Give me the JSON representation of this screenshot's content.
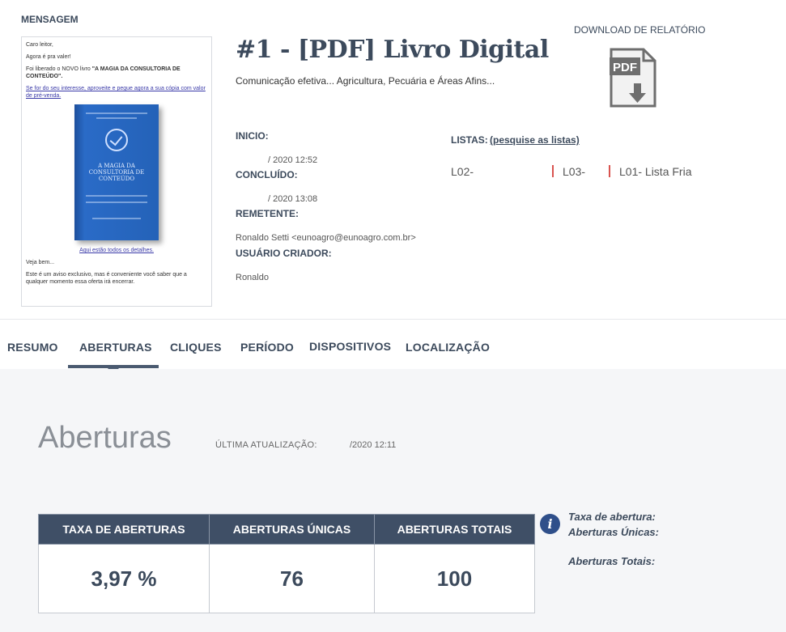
{
  "header": {
    "message_label": "MENSAGEM",
    "title": "#1 - [PDF] Livro Digital",
    "subtitle": "Comunicação efetiva... Agricultura, Pecuária e Áreas Afins...",
    "download_label": "DOWNLOAD DE RELATÓRIO"
  },
  "preview": {
    "line1": "Caro leitor,",
    "line2": "Agora é pra valer!",
    "line3_prefix": "Foi liberado o NOVO livro ",
    "line3_bold": "\"A MAGIA DA CONSULTORIA DE CONTEÚDO\".",
    "link1": "Se for do seu interesse, aproveite e pegue agora a sua cópia com valor de pré-venda.",
    "book_title": "A MAGIA DA CONSULTORIA DE CONTEÚDO",
    "link2": "Aqui estão todos os detalhes.",
    "line4": "Veja bem...",
    "line5": "Este é um aviso exclusivo, mas é conveniente você saber que a qualquer momento essa oferta irá encerrar."
  },
  "meta": {
    "inicio_label": "INICIO:",
    "inicio_value": "/ 2020 12:52",
    "concluido_label": "CONCLUÍDO:",
    "concluido_value": "/ 2020 13:08",
    "remetente_label": "REMETENTE:",
    "remetente_value": "Ronaldo Setti <eunoagro@eunoagro.com.br>",
    "usuario_label": "USUÁRIO CRIADOR:",
    "usuario_value": "Ronaldo"
  },
  "lists": {
    "label": "LISTAS:",
    "link": "(pesquise as listas)",
    "items": [
      "L02-",
      "L03-",
      "L01- Lista Fria"
    ]
  },
  "tabs": [
    "RESUMO",
    "ABERTURAS",
    "CLIQUES",
    "PERÍODO",
    "DISPOSITIVOS",
    "LOCALIZAÇÃO"
  ],
  "active_tab": "ABERTURAS",
  "section": {
    "title": "Aberturas",
    "updated_label": "ÚLTIMA ATUALIZAÇÃO:",
    "updated_value": "/2020 12:11"
  },
  "stats": {
    "headers": [
      "TAXA DE ABERTURAS",
      "ABERTURAS ÚNICAS",
      "ABERTURAS TOTAIS"
    ],
    "values": [
      "3,97 %",
      "76",
      "100"
    ]
  },
  "info": {
    "icon": "info-icon",
    "lines": [
      "Taxa de abertura:",
      "Aberturas Únicas:",
      "Aberturas Totais:"
    ]
  },
  "colors": {
    "header_bg": "#3f4f66",
    "accent_text": "#3c4a5c",
    "list_separator": "#d9534f",
    "content_bg": "#f5f6f8"
  }
}
